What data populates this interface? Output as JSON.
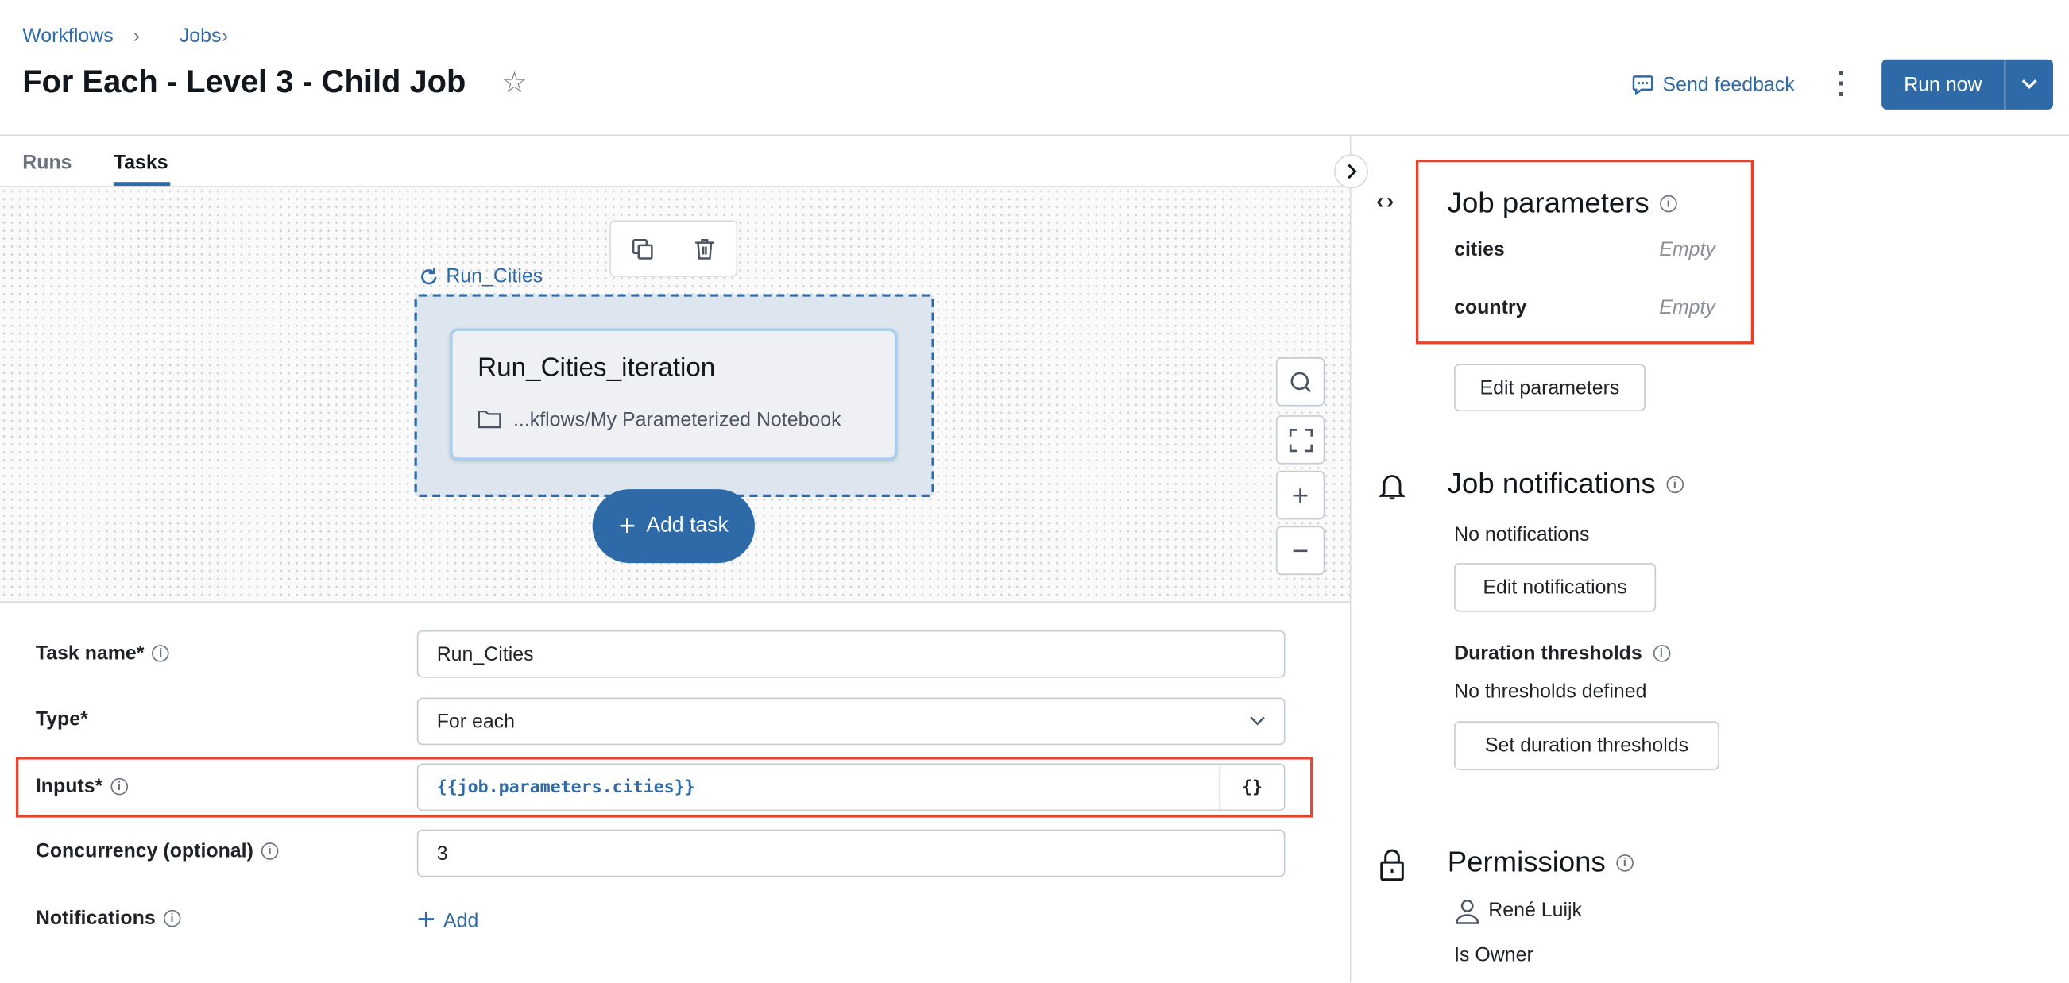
{
  "breadcrumb": [
    "Workflows",
    "Jobs"
  ],
  "header": {
    "title": "For Each - Level 3 - Child Job",
    "send_feedback": "Send feedback",
    "run_now": "Run now"
  },
  "tabs": [
    {
      "label": "Runs",
      "active": false
    },
    {
      "label": "Tasks",
      "active": true
    }
  ],
  "canvas": {
    "loop_label": "Run_Cities",
    "task_card": {
      "title": "Run_Cities_iteration",
      "path": "...kflows/My Parameterized Notebook"
    },
    "add_task": "Add task"
  },
  "form": {
    "task_name": {
      "label": "Task name*",
      "value": "Run_Cities"
    },
    "type": {
      "label": "Type*",
      "value": "For each"
    },
    "inputs": {
      "label": "Inputs*",
      "value": "{{job.parameters.cities}}",
      "button": "{}"
    },
    "concurrency": {
      "label": "Concurrency (optional)",
      "value": "3"
    },
    "notifications": {
      "label": "Notifications",
      "add": "Add"
    }
  },
  "side": {
    "job_parameters": {
      "title": "Job parameters",
      "params": [
        {
          "name": "cities",
          "value": "Empty"
        },
        {
          "name": "country",
          "value": "Empty"
        }
      ],
      "edit": "Edit parameters"
    },
    "job_notifications": {
      "title": "Job notifications",
      "status": "No notifications",
      "edit": "Edit notifications",
      "duration_title": "Duration thresholds",
      "duration_status": "No thresholds defined",
      "duration_button": "Set duration thresholds"
    },
    "permissions": {
      "title": "Permissions",
      "user": "René Luijk",
      "role": "Is Owner"
    }
  },
  "colors": {
    "accent": "#2f6aa8",
    "highlight": "#e5432a"
  }
}
